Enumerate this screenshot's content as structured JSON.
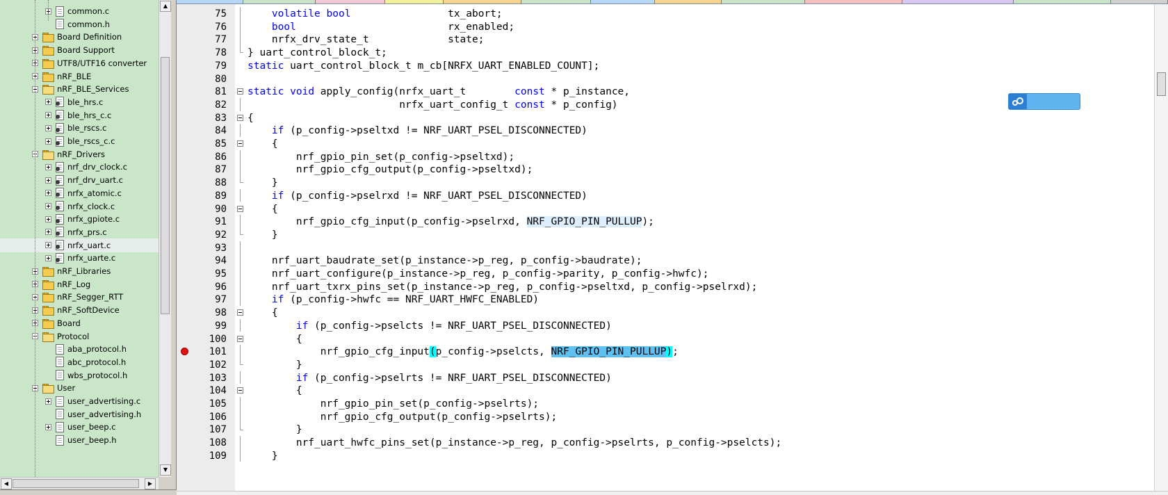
{
  "project_tree": {
    "rows": [
      {
        "label": "common.c",
        "kind": "file",
        "expander": "plus",
        "level": 2,
        "c_src": false
      },
      {
        "label": "common.h",
        "kind": "file",
        "expander": "none",
        "level": 2,
        "c_src": false
      },
      {
        "label": "Board Definition",
        "kind": "folder",
        "expander": "plus",
        "level": 1
      },
      {
        "label": "Board Support",
        "kind": "folder",
        "expander": "plus",
        "level": 1
      },
      {
        "label": "UTF8/UTF16 converter",
        "kind": "folder",
        "expander": "plus",
        "level": 1
      },
      {
        "label": "nRF_BLE",
        "kind": "folder",
        "expander": "plus",
        "level": 1
      },
      {
        "label": "nRF_BLE_Services",
        "kind": "folder-open",
        "expander": "minus",
        "level": 1
      },
      {
        "label": "ble_hrs.c",
        "kind": "file",
        "expander": "plus",
        "level": 2,
        "c_src": true
      },
      {
        "label": "ble_hrs_c.c",
        "kind": "file",
        "expander": "plus",
        "level": 2,
        "c_src": true
      },
      {
        "label": "ble_rscs.c",
        "kind": "file",
        "expander": "plus",
        "level": 2,
        "c_src": true
      },
      {
        "label": "ble_rscs_c.c",
        "kind": "file",
        "expander": "plus",
        "level": 2,
        "c_src": true
      },
      {
        "label": "nRF_Drivers",
        "kind": "folder-open",
        "expander": "minus",
        "level": 1
      },
      {
        "label": "nrf_drv_clock.c",
        "kind": "file",
        "expander": "plus",
        "level": 2,
        "c_src": true
      },
      {
        "label": "nrf_drv_uart.c",
        "kind": "file",
        "expander": "plus",
        "level": 2,
        "c_src": true
      },
      {
        "label": "nrfx_atomic.c",
        "kind": "file",
        "expander": "plus",
        "level": 2,
        "c_src": true
      },
      {
        "label": "nrfx_clock.c",
        "kind": "file",
        "expander": "plus",
        "level": 2,
        "c_src": true
      },
      {
        "label": "nrfx_gpiote.c",
        "kind": "file",
        "expander": "plus",
        "level": 2,
        "c_src": true
      },
      {
        "label": "nrfx_prs.c",
        "kind": "file",
        "expander": "plus",
        "level": 2,
        "c_src": true
      },
      {
        "label": "nrfx_uart.c",
        "kind": "file",
        "expander": "plus",
        "level": 2,
        "c_src": true,
        "selected": true
      },
      {
        "label": "nrfx_uarte.c",
        "kind": "file",
        "expander": "plus",
        "level": 2,
        "c_src": true
      },
      {
        "label": "nRF_Libraries",
        "kind": "folder",
        "expander": "plus",
        "level": 1
      },
      {
        "label": "nRF_Log",
        "kind": "folder",
        "expander": "plus",
        "level": 1
      },
      {
        "label": "nRF_Segger_RTT",
        "kind": "folder",
        "expander": "plus",
        "level": 1
      },
      {
        "label": "nRF_SoftDevice",
        "kind": "folder",
        "expander": "plus",
        "level": 1
      },
      {
        "label": "Board",
        "kind": "folder",
        "expander": "plus",
        "level": 1
      },
      {
        "label": "Protocol",
        "kind": "folder-open",
        "expander": "minus",
        "level": 1
      },
      {
        "label": "aba_protocol.h",
        "kind": "file",
        "expander": "none",
        "level": 2,
        "c_src": false
      },
      {
        "label": "abc_protocol.h",
        "kind": "file",
        "expander": "none",
        "level": 2,
        "c_src": false
      },
      {
        "label": "wbs_protocol.h",
        "kind": "file",
        "expander": "none",
        "level": 2,
        "c_src": false
      },
      {
        "label": "User",
        "kind": "folder-open",
        "expander": "minus",
        "level": 1
      },
      {
        "label": "user_advertising.c",
        "kind": "file",
        "expander": "plus",
        "level": 2,
        "c_src": false
      },
      {
        "label": "user_advertising.h",
        "kind": "file",
        "expander": "none",
        "level": 2,
        "c_src": false
      },
      {
        "label": "user_beep.c",
        "kind": "file",
        "expander": "plus",
        "level": 2,
        "c_src": false
      },
      {
        "label": "user_beep.h",
        "kind": "file",
        "expander": "none",
        "level": 2,
        "c_src": false
      }
    ]
  },
  "editor": {
    "tab_colors": [
      "#b7d7f7",
      "#c9e3c9",
      "#f3c6d6",
      "#f2f29a",
      "#f7d58f",
      "#c9e3c9",
      "#b7d7f7",
      "#f7d58f",
      "#c9e3c9",
      "#f7c0c0",
      "#d9c8f0",
      "#c9e3c9",
      "#d0d0d0"
    ],
    "code_lines": [
      {
        "num": "75",
        "fold": "line",
        "tokens": [
          {
            "t": "    "
          },
          {
            "t": "volatile",
            "c": "kw"
          },
          {
            "t": " "
          },
          {
            "t": "bool",
            "c": "kw"
          },
          {
            "t": "                tx_abort;"
          }
        ]
      },
      {
        "num": "76",
        "fold": "line",
        "tokens": [
          {
            "t": "    "
          },
          {
            "t": "bool",
            "c": "kw"
          },
          {
            "t": "                         rx_enabled;"
          }
        ]
      },
      {
        "num": "77",
        "fold": "line",
        "tokens": [
          {
            "t": "    nrfx_drv_state_t             state;"
          }
        ]
      },
      {
        "num": "78",
        "fold": "end",
        "tokens": [
          {
            "t": "} uart_control_block_t;"
          }
        ]
      },
      {
        "num": "79",
        "fold": "none",
        "tokens": [
          {
            "t": "static",
            "c": "kw"
          },
          {
            "t": " uart_control_block_t m_cb[NRFX_UART_ENABLED_COUNT];"
          }
        ]
      },
      {
        "num": "80",
        "fold": "none",
        "tokens": [
          {
            "t": ""
          }
        ]
      },
      {
        "num": "81",
        "fold": "box",
        "tokens": [
          {
            "t": "static",
            "c": "kw"
          },
          {
            "t": " "
          },
          {
            "t": "void",
            "c": "kw"
          },
          {
            "t": " apply_config(nrfx_uart_t        "
          },
          {
            "t": "const",
            "c": "kw"
          },
          {
            "t": " * p_instance,"
          }
        ]
      },
      {
        "num": "82",
        "fold": "line",
        "tokens": [
          {
            "t": "                         nrfx_uart_config_t "
          },
          {
            "t": "const",
            "c": "kw"
          },
          {
            "t": " * p_config)"
          }
        ]
      },
      {
        "num": "83",
        "fold": "box",
        "tokens": [
          {
            "t": "{"
          }
        ]
      },
      {
        "num": "84",
        "fold": "line",
        "tokens": [
          {
            "t": "    "
          },
          {
            "t": "if",
            "c": "kw"
          },
          {
            "t": " (p_config->pseltxd != NRF_UART_PSEL_DISCONNECTED)"
          }
        ]
      },
      {
        "num": "85",
        "fold": "box",
        "tokens": [
          {
            "t": "    {"
          }
        ]
      },
      {
        "num": "86",
        "fold": "line",
        "tokens": [
          {
            "t": "        nrf_gpio_pin_set(p_config->pseltxd);"
          }
        ]
      },
      {
        "num": "87",
        "fold": "line",
        "tokens": [
          {
            "t": "        nrf_gpio_cfg_output(p_config->pseltxd);"
          }
        ]
      },
      {
        "num": "88",
        "fold": "end",
        "tokens": [
          {
            "t": "    }"
          }
        ]
      },
      {
        "num": "89",
        "fold": "line",
        "tokens": [
          {
            "t": "    "
          },
          {
            "t": "if",
            "c": "kw"
          },
          {
            "t": " (p_config->pselrxd != NRF_UART_PSEL_DISCONNECTED)"
          }
        ]
      },
      {
        "num": "90",
        "fold": "box",
        "tokens": [
          {
            "t": "    {"
          }
        ]
      },
      {
        "num": "91",
        "fold": "line",
        "tokens": [
          {
            "t": "        nrf_gpio_cfg_input(p_config->pselrxd, "
          },
          {
            "t": "NRF_GPIO_PIN_PULLUP",
            "c": "hl-match"
          },
          {
            "t": ");"
          }
        ]
      },
      {
        "num": "92",
        "fold": "end",
        "tokens": [
          {
            "t": "    }"
          }
        ]
      },
      {
        "num": "93",
        "fold": "line",
        "tokens": [
          {
            "t": ""
          }
        ]
      },
      {
        "num": "94",
        "fold": "line",
        "tokens": [
          {
            "t": "    nrf_uart_baudrate_set(p_instance->p_reg, p_config->baudrate);"
          }
        ]
      },
      {
        "num": "95",
        "fold": "line",
        "tokens": [
          {
            "t": "    nrf_uart_configure(p_instance->p_reg, p_config->parity, p_config->hwfc);"
          }
        ]
      },
      {
        "num": "96",
        "fold": "line",
        "tokens": [
          {
            "t": "    nrf_uart_txrx_pins_set(p_instance->p_reg, p_config->pseltxd, p_config->pselrxd);"
          }
        ]
      },
      {
        "num": "97",
        "fold": "line",
        "tokens": [
          {
            "t": "    "
          },
          {
            "t": "if",
            "c": "kw"
          },
          {
            "t": " (p_config->hwfc == NRF_UART_HWFC_ENABLED)"
          }
        ]
      },
      {
        "num": "98",
        "fold": "box",
        "tokens": [
          {
            "t": "    {"
          }
        ]
      },
      {
        "num": "99",
        "fold": "line",
        "tokens": [
          {
            "t": "        "
          },
          {
            "t": "if",
            "c": "kw"
          },
          {
            "t": " (p_config->pselcts != NRF_UART_PSEL_DISCONNECTED)"
          }
        ]
      },
      {
        "num": "100",
        "fold": "box",
        "tokens": [
          {
            "t": "        {"
          }
        ]
      },
      {
        "num": "101",
        "fold": "line",
        "breakpoint": true,
        "tokens": [
          {
            "t": "            nrf_gpio_cfg_input"
          },
          {
            "t": "(",
            "c": "hl-brace"
          },
          {
            "t": "p_config->pselcts, "
          },
          {
            "t": "NRF_GPIO_PIN_PULLUP",
            "c": "hl-sel"
          },
          {
            "t": ")",
            "c": "hl-brace"
          },
          {
            "t": ";"
          }
        ]
      },
      {
        "num": "102",
        "fold": "end",
        "tokens": [
          {
            "t": "        }"
          }
        ]
      },
      {
        "num": "103",
        "fold": "line",
        "tokens": [
          {
            "t": "        "
          },
          {
            "t": "if",
            "c": "kw"
          },
          {
            "t": " (p_config->pselrts != NRF_UART_PSEL_DISCONNECTED)"
          }
        ]
      },
      {
        "num": "104",
        "fold": "box",
        "tokens": [
          {
            "t": "        {"
          }
        ]
      },
      {
        "num": "105",
        "fold": "line",
        "tokens": [
          {
            "t": "            nrf_gpio_pin_set(p_config->pselrts);"
          }
        ]
      },
      {
        "num": "106",
        "fold": "line",
        "tokens": [
          {
            "t": "            nrf_gpio_cfg_output(p_config->pselrts);"
          }
        ]
      },
      {
        "num": "107",
        "fold": "end",
        "tokens": [
          {
            "t": "        }"
          }
        ]
      },
      {
        "num": "108",
        "fold": "line",
        "tokens": [
          {
            "t": "        nrf_uart_hwfc_pins_set(p_instance->p_reg, p_config->pselrts, p_config->pselcts);"
          }
        ]
      },
      {
        "num": "109",
        "fold": "line",
        "tokens": [
          {
            "t": "    }"
          }
        ]
      }
    ]
  },
  "colors": {
    "tree_background": "#c9e6c9",
    "keyword": "#0000ff",
    "breakpoint": "#e01010",
    "selection": "#5ec1f1",
    "brace_match": "#00ffff",
    "upload_badge": "#5fb4f0"
  },
  "icons": {
    "tree_folder": "folder-icon",
    "tree_file": "file-icon",
    "badge": "cloud-icon",
    "breakpoint": "breakpoint-icon"
  }
}
